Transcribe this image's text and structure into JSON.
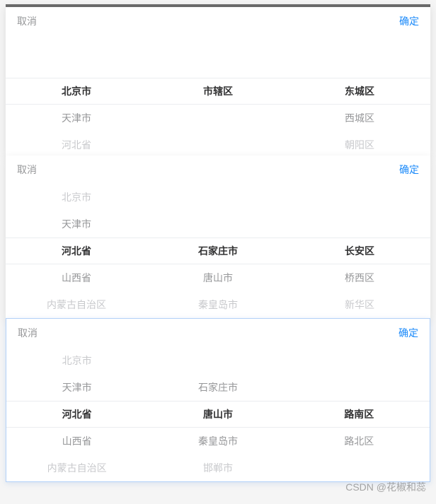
{
  "common": {
    "cancel": "取消",
    "confirm": "确定"
  },
  "panel1": {
    "col1": {
      "r0": "",
      "r1": "北京市",
      "r2": "天津市",
      "r3": "河北省"
    },
    "col2": {
      "r0": "",
      "r1": "市辖区",
      "r2": "",
      "r3": ""
    },
    "col3": {
      "r0": "",
      "r1": "东城区",
      "r2": "西城区",
      "r3": "朝阳区"
    }
  },
  "panel2": {
    "col1": {
      "r0": "北京市",
      "r1": "天津市",
      "r2": "河北省",
      "r3": "山西省",
      "r4": "内蒙古自治区"
    },
    "col2": {
      "r0": "",
      "r1": "",
      "r2": "石家庄市",
      "r3": "唐山市",
      "r4": "秦皇岛市"
    },
    "col3": {
      "r0": "",
      "r1": "",
      "r2": "长安区",
      "r3": "桥西区",
      "r4": "新华区"
    }
  },
  "panel3": {
    "col1": {
      "r0": "北京市",
      "r1": "天津市",
      "r2": "河北省",
      "r3": "山西省",
      "r4": "内蒙古自治区"
    },
    "col2": {
      "r0": "",
      "r1": "石家庄市",
      "r2": "唐山市",
      "r3": "秦皇岛市",
      "r4": "邯郸市"
    },
    "col3": {
      "r0": "",
      "r1": "",
      "r2": "路南区",
      "r3": "路北区",
      "r4": ""
    }
  },
  "watermark": "CSDN @花椒和蕊"
}
